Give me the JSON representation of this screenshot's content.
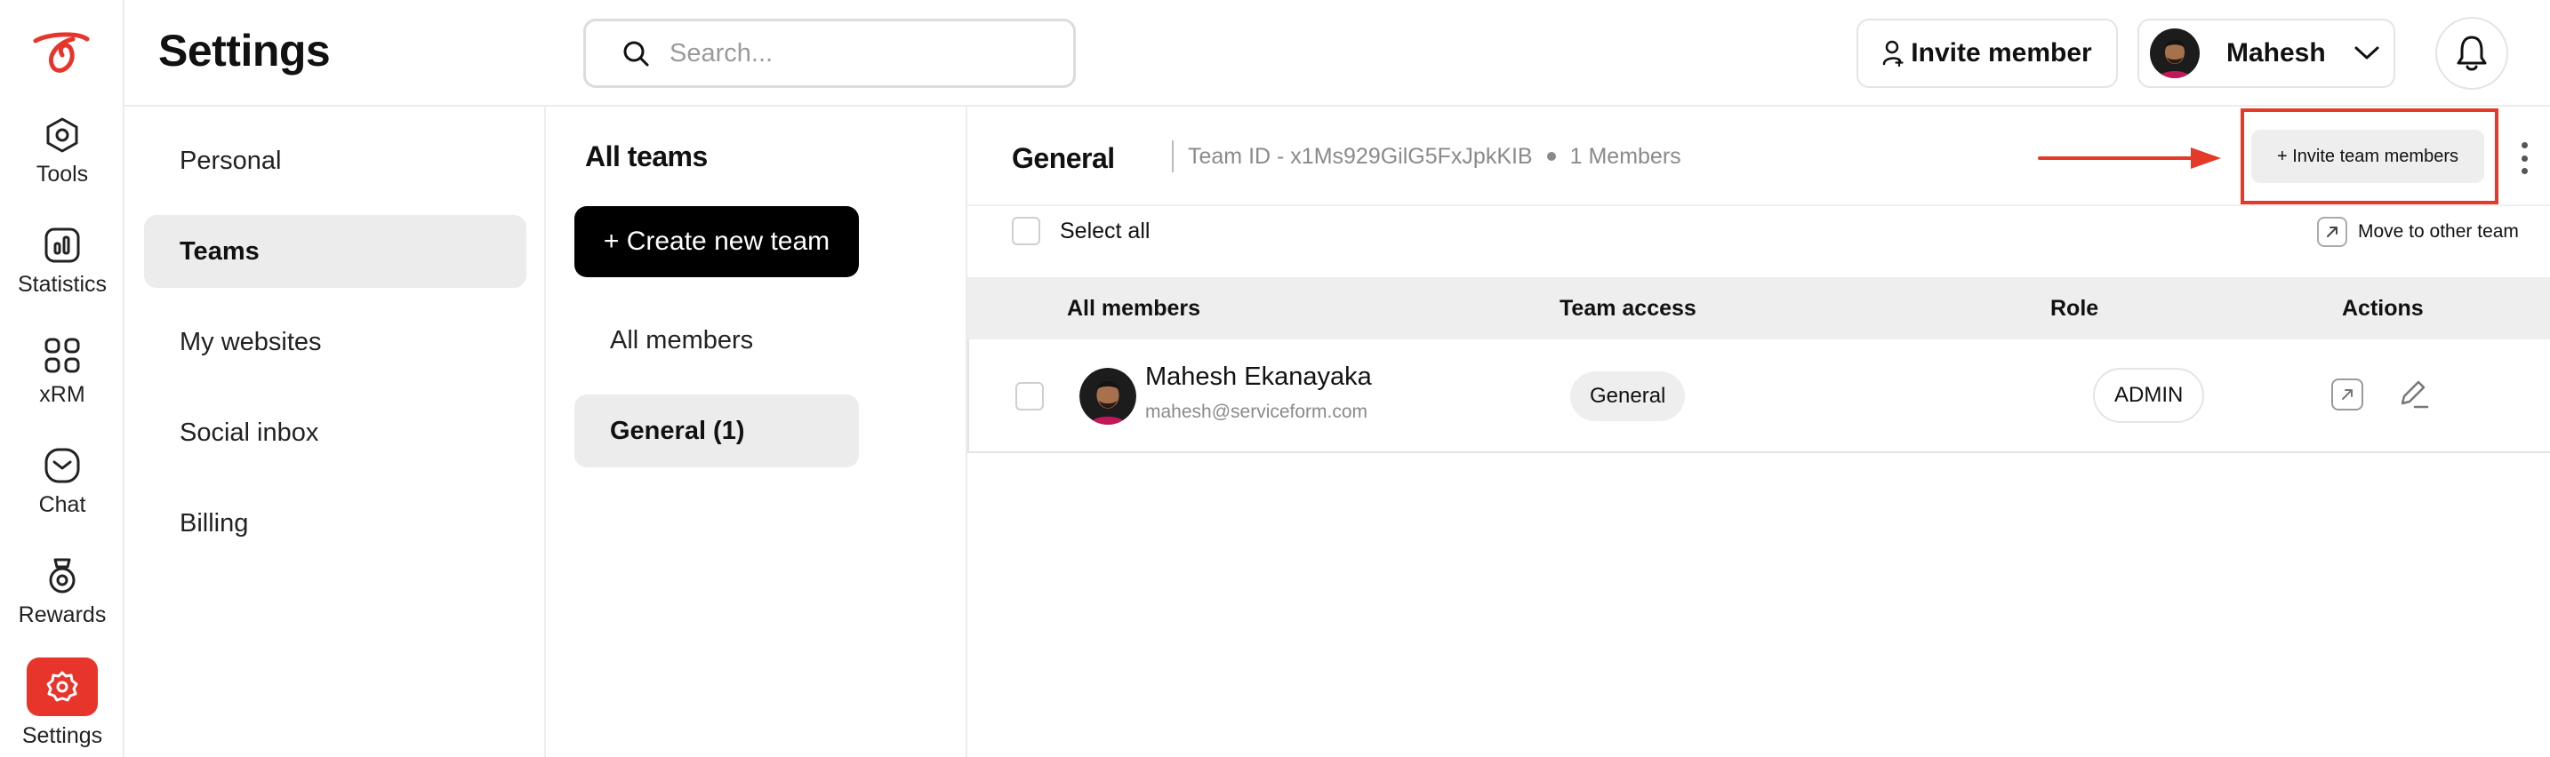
{
  "rail": {
    "items": [
      {
        "label": "Tools",
        "icon": "tools-icon"
      },
      {
        "label": "Statistics",
        "icon": "statistics-icon"
      },
      {
        "label": "xRM",
        "icon": "grid-icon"
      },
      {
        "label": "Chat",
        "icon": "chat-icon"
      },
      {
        "label": "Rewards",
        "icon": "rewards-icon"
      },
      {
        "label": "Settings",
        "icon": "gear-icon",
        "active": true
      }
    ]
  },
  "header": {
    "title": "Settings",
    "search_placeholder": "Search...",
    "invite_label": "Invite member",
    "user_name": "Mahesh"
  },
  "settings_nav": {
    "items": [
      {
        "label": "Personal"
      },
      {
        "label": "Teams",
        "active": true
      },
      {
        "label": "My websites"
      },
      {
        "label": "Social inbox"
      },
      {
        "label": "Billing"
      }
    ]
  },
  "teams": {
    "title": "All teams",
    "create_label": "+ Create new team",
    "items": [
      {
        "label": "All members"
      },
      {
        "label": "General (1)",
        "active": true
      }
    ]
  },
  "main": {
    "team_name": "General",
    "team_id": "Team ID - x1Ms929GilG5FxJpkKIB",
    "members_count": "1 Members",
    "invite_team_label": "+ Invite team members",
    "select_all_label": "Select all",
    "move_label": "Move to other team",
    "columns": [
      "All members",
      "Team access",
      "Role",
      "Actions"
    ],
    "rows": [
      {
        "name": "Mahesh Ekanayaka",
        "email": "mahesh@serviceform.com",
        "access": "General",
        "role": "ADMIN"
      }
    ]
  },
  "colors": {
    "brand": "#e8352b",
    "highlight": "#e33a2a",
    "muted_bg": "#eeeeee"
  }
}
